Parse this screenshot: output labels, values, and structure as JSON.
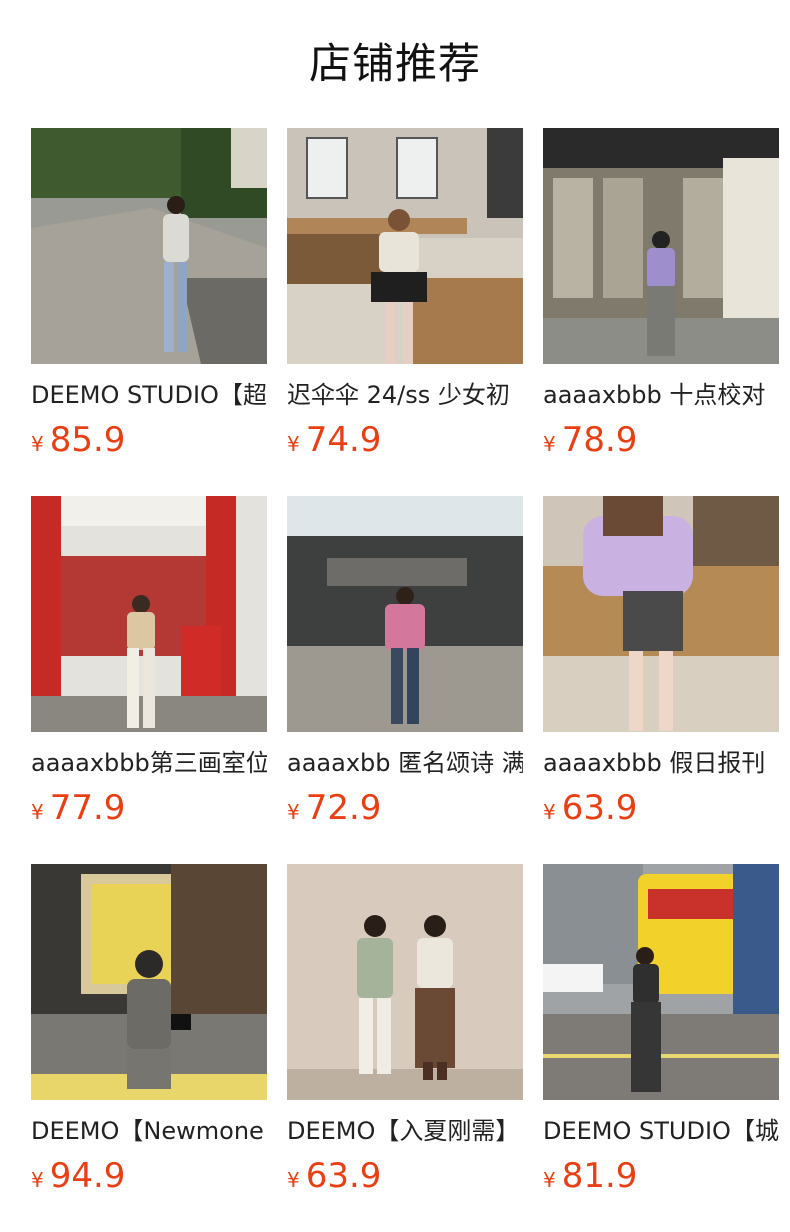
{
  "section": {
    "title": "店铺推荐"
  },
  "currency_symbol": "¥",
  "products": [
    {
      "name": "DEEMO STUDIO【超",
      "price": "85.9"
    },
    {
      "name": "迟伞伞 24/ss 少女初",
      "price": "74.9"
    },
    {
      "name": "aaaaxbbb 十点校对",
      "price": "78.9"
    },
    {
      "name": "aaaaxbbb第三画室位",
      "price": "77.9"
    },
    {
      "name": "aaaaxbb 匿名颂诗 满",
      "price": "72.9"
    },
    {
      "name": "aaaaxbbb 假日报刊",
      "price": "63.9"
    },
    {
      "name": "DEEMO【Newmone",
      "price": "94.9"
    },
    {
      "name": "DEEMO【入夏刚需】",
      "price": "63.9"
    },
    {
      "name": "DEEMO STUDIO【城",
      "price": "81.9"
    }
  ]
}
